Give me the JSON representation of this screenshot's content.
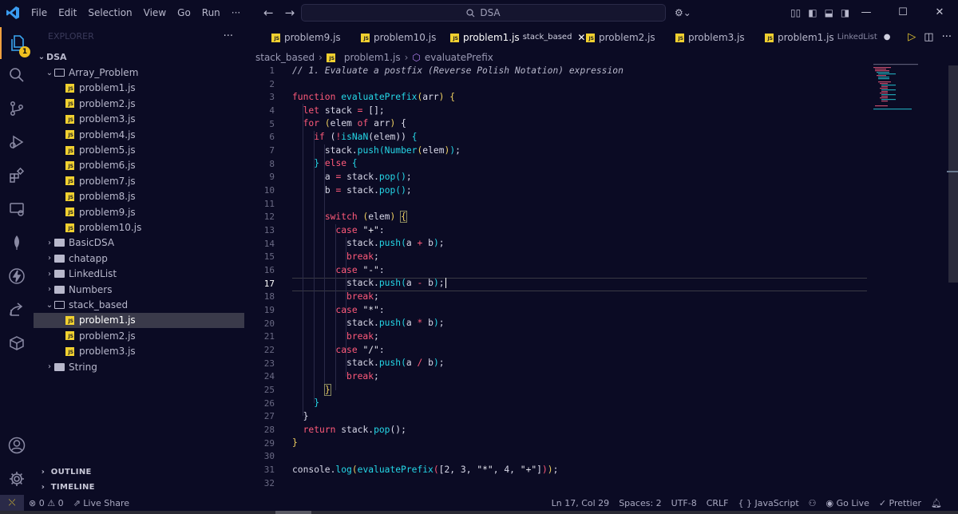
{
  "titlebar": {
    "menu": [
      "File",
      "Edit",
      "Selection",
      "View",
      "Go",
      "Run",
      "···"
    ],
    "search": "DSA",
    "win_min": "—",
    "win_max": "☐",
    "win_close": "✕"
  },
  "activity": {
    "badge": "1"
  },
  "sidebar": {
    "header": "EXPLORER",
    "more": "···",
    "root": "DSA",
    "folder_array": "Array_Problem",
    "array_files": [
      "problem1.js",
      "problem2.js",
      "problem3.js",
      "problem4.js",
      "problem5.js",
      "problem6.js",
      "problem7.js",
      "problem8.js",
      "problem9.js",
      "problem10.js"
    ],
    "folders_closed": [
      "BasicDSA",
      "chatapp",
      "LinkedList",
      "Numbers"
    ],
    "folder_stack": "stack_based",
    "stack_files": [
      "problem1.js",
      "problem2.js",
      "problem3.js"
    ],
    "folder_string": "String",
    "outline": "OUTLINE",
    "timeline": "TIMELINE"
  },
  "tabs": [
    {
      "name": "problem9.js",
      "desc": ""
    },
    {
      "name": "problem10.js",
      "desc": ""
    },
    {
      "name": "problem1.js",
      "desc": "stack_based"
    },
    {
      "name": "problem2.js",
      "desc": ""
    },
    {
      "name": "problem3.js",
      "desc": ""
    },
    {
      "name": "problem1.js",
      "desc": "LinkedList"
    }
  ],
  "breadcrumb": {
    "folder": "stack_based",
    "file": "problem1.js",
    "symbol": "evaluatePrefix"
  },
  "editor": {
    "current_line": 17,
    "line_numbers": [
      "1",
      "2",
      "3",
      "4",
      "5",
      "6",
      "7",
      "8",
      "9",
      "10",
      "11",
      "12",
      "13",
      "14",
      "15",
      "16",
      "17",
      "18",
      "19",
      "20",
      "21",
      "22",
      "23",
      "24",
      "25",
      "26",
      "27",
      "28",
      "29",
      "30",
      "31",
      "32"
    ]
  },
  "status": {
    "problems": "⊗ 0 ⚠ 0",
    "live_share": "Live Share",
    "position": "Ln 17, Col 29",
    "spaces": "Spaces: 2",
    "encoding": "UTF-8",
    "eol": "CRLF",
    "language": "{ } JavaScript",
    "go_live": "Go Live",
    "prettier": "✓ Prettier"
  },
  "colors": {
    "background": "#0b0b24",
    "keyword": "#ff5a7a",
    "function": "#25d8e8",
    "bracket": "#f0d060",
    "js_icon": "#f0d030",
    "selected_row": "#3a3a4a"
  }
}
